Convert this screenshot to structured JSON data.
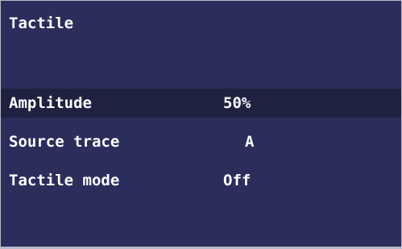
{
  "screen": {
    "title": "Tactile",
    "colors": {
      "background": "#2b2d5b",
      "selected_row": "#1f2140",
      "text": "#ffffff"
    }
  },
  "menu": {
    "items": [
      {
        "label": "Amplitude",
        "value": "50%",
        "selected": true
      },
      {
        "label": "Source trace",
        "value": "A",
        "selected": false
      },
      {
        "label": "Tactile mode",
        "value": "Off",
        "selected": false
      }
    ]
  }
}
